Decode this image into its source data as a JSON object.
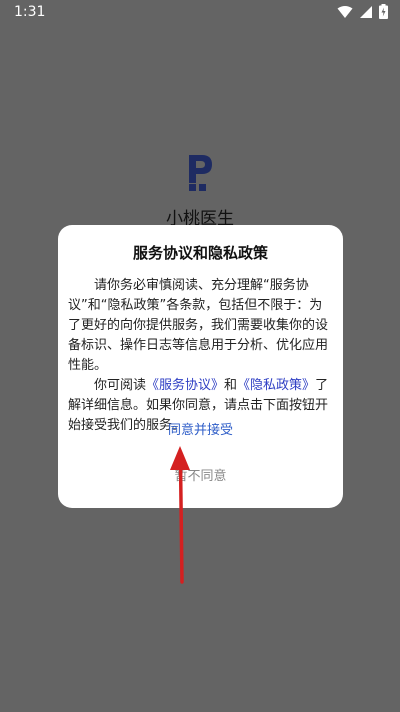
{
  "status_bar": {
    "time": "1:31",
    "icons": [
      "wifi-icon",
      "cellular-signal-icon",
      "battery-charging-icon"
    ]
  },
  "splash": {
    "app_name": "小桃医生",
    "logo": "p-logo"
  },
  "dialog": {
    "title": "服务协议和隐私政策",
    "paragraph1": "请你务必审慎阅读、充分理解“服务协议”和“隐私政策”各条款，包括但不限于：为了更好的向你提供服务，我们需要收集你的设备标识、操作日志等信息用于分析、优化应用性能。",
    "p2_prefix": "你可阅读",
    "service_link": "《服务协议》",
    "p2_and": "和",
    "privacy_link": "《隐私政策》",
    "p2_suffix": "了解详细信息。如果你同意，请点击下面按钮开始接受我们的服务。",
    "agree_label": "同意并接受",
    "disagree_label": "暂不同意"
  },
  "colors": {
    "overlay": "#646464",
    "link": "#2f3fc4",
    "accept_button": "#2f5ec8",
    "annotation_arrow": "#d42020"
  }
}
